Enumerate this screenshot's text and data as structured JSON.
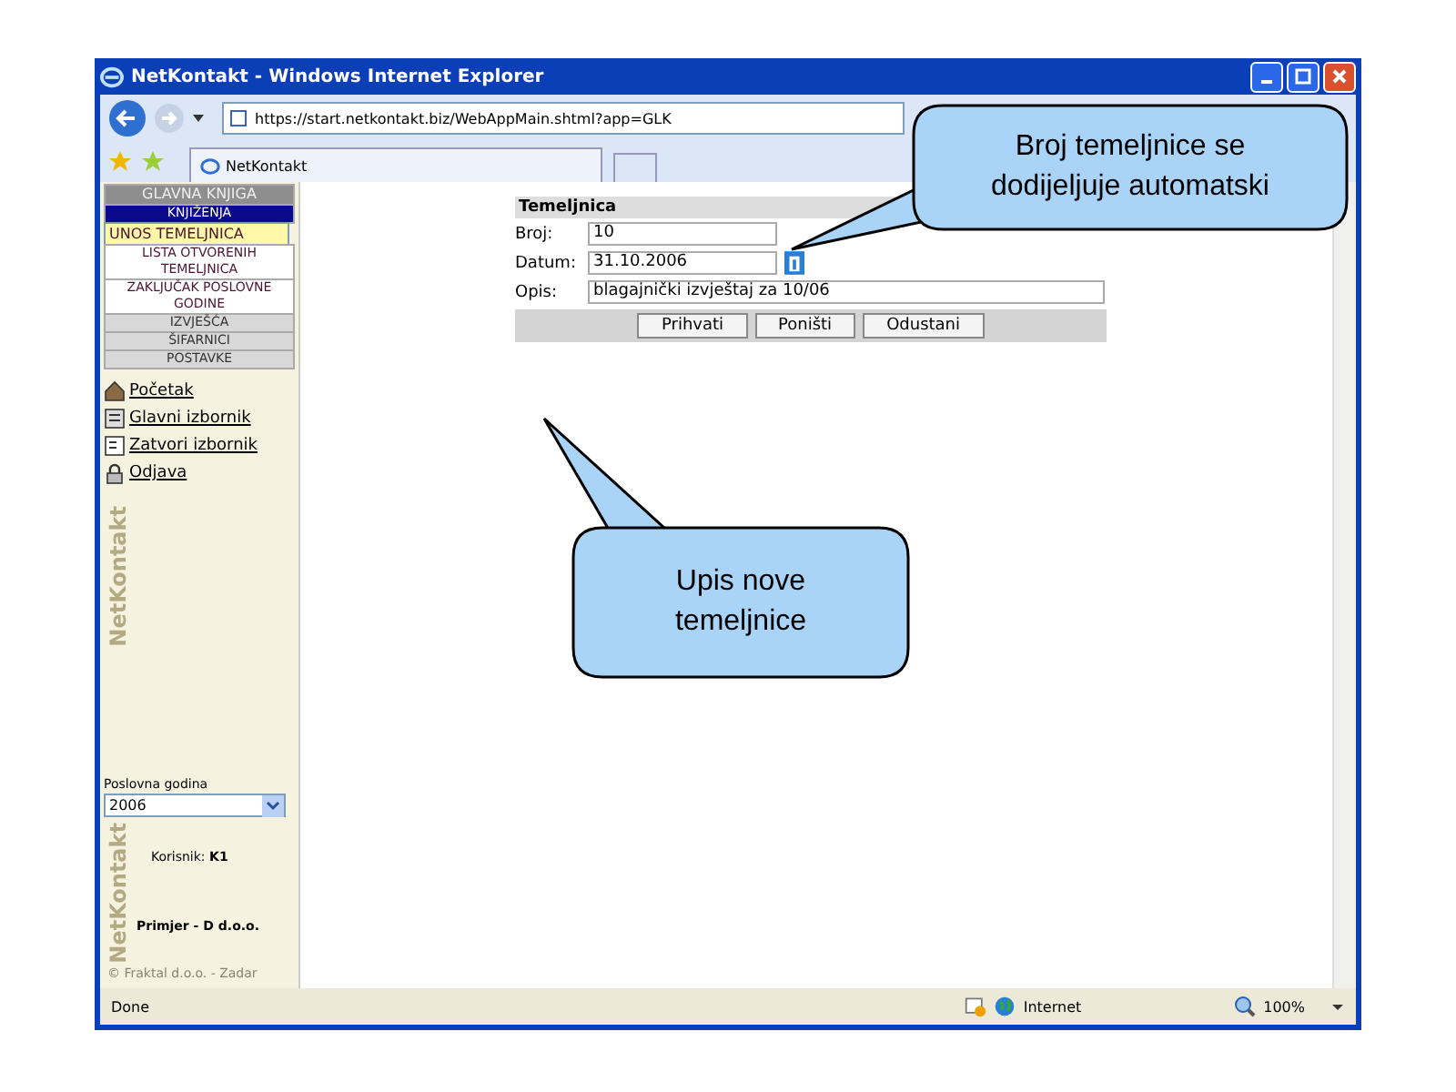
{
  "window": {
    "title": "NetKontakt - Windows Internet Explorer"
  },
  "browser": {
    "address": "https://start.netkontakt.biz/WebAppMain.shtml?app=GLK",
    "tab": "NetKontakt"
  },
  "sidebar": {
    "menu": [
      {
        "label": "GLAVNA KNJIGA",
        "kind": "header"
      },
      {
        "label": "KNJIŽENJA",
        "kind": "section"
      },
      {
        "label": "UNOS TEMELJNICA",
        "kind": "item",
        "selected": true
      },
      {
        "label": "LISTA OTVORENIH TEMELJNICA",
        "kind": "item",
        "selected": false
      },
      {
        "label": "ZAKLJUČAK POSLOVNE GODINE",
        "kind": "item",
        "selected": false
      },
      {
        "label": "IZVJEŠĆA",
        "kind": "group"
      },
      {
        "label": "ŠIFARNICI",
        "kind": "group"
      },
      {
        "label": "POSTAVKE",
        "kind": "group"
      }
    ],
    "links": [
      {
        "label": "Početak",
        "kind": "home"
      },
      {
        "label": "Glavni izbornik",
        "kind": "menu"
      },
      {
        "label": "Zatvori izbornik",
        "kind": "close"
      },
      {
        "label": "Odjava",
        "kind": "lock"
      }
    ],
    "logo_texts": [
      "NetKontakt",
      "NetKontakt"
    ],
    "year_label": "Poslovna godina",
    "year_value": "2006",
    "user_label": "Korisnik:",
    "user_value": "K1",
    "company": "Primjer - D d.o.o.",
    "copyright": "© Fraktal d.o.o. - Zadar"
  },
  "form": {
    "title": "Temeljnica",
    "fields": [
      {
        "label": "Broj:",
        "value": "10",
        "kind": "text"
      },
      {
        "label": "Datum:",
        "value": "31.10.2006",
        "kind": "date"
      },
      {
        "label": "Opis:",
        "value": "blagajnički izvještaj za 10/06",
        "kind": "wide"
      }
    ],
    "buttons": [
      "Prihvati",
      "Poništi",
      "Odustani"
    ]
  },
  "callouts": [
    {
      "text": "Broj temeljnice se dodijeljuje automatski"
    },
    {
      "text": "Upis nove temeljnice"
    }
  ],
  "status_bar": {
    "text": "Done",
    "zone": "Internet",
    "zoom": "100%"
  }
}
